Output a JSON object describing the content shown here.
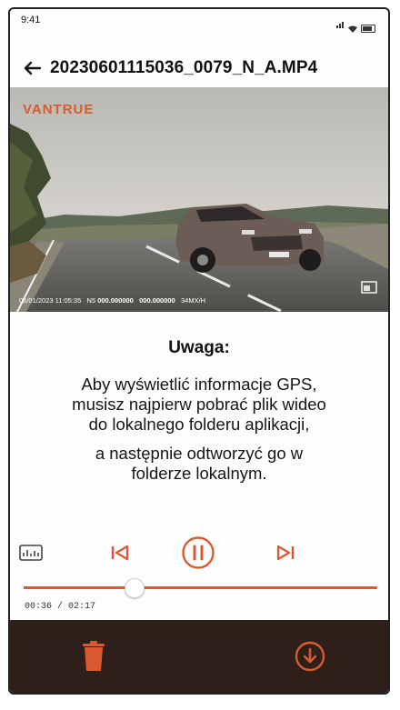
{
  "status_bar": {
    "time": "9:41"
  },
  "header": {
    "title": "20230601115036_0079_N_A.MP4"
  },
  "video": {
    "brand": "VANTRUE",
    "datetime": "06/01/2023 11:05:35",
    "lat_prefix": "N5",
    "lat": "000.000000",
    "lon": "000.000000",
    "speed": "34MX/H"
  },
  "notice": {
    "title": "Uwaga:",
    "line1": "Aby wyświetlić informacje GPS,",
    "line2": "musisz najpierw pobrać plik wideo",
    "line3": "do lokalnego folderu aplikacji,",
    "line4": "a następnie odtworzyć go w",
    "line5": "folderze lokalnym."
  },
  "player": {
    "progress_fraction": 0.31,
    "time_readout": "00:36 / 02:17"
  },
  "colors": {
    "accent": "#d95a2e",
    "bottom_bar": "#2e1f1a"
  },
  "icons": {
    "back": "back-arrow-icon",
    "info": "gps-info-icon",
    "prev": "skip-previous-icon",
    "pause": "pause-icon",
    "next": "skip-next-icon",
    "fullscreen": "fullscreen-icon",
    "delete": "trash-icon",
    "download": "download-icon"
  }
}
